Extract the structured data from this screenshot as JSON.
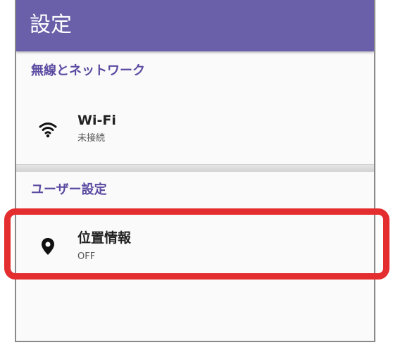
{
  "appbar": {
    "title": "設定"
  },
  "sections": [
    {
      "header": "無線とネットワーク",
      "items": [
        {
          "icon": "wifi-icon",
          "title": "Wi-Fi",
          "subtitle": "未接続"
        }
      ]
    },
    {
      "header": "ユーザー設定",
      "items": [
        {
          "icon": "location-pin-icon",
          "title": "位置情報",
          "subtitle": "OFF"
        }
      ]
    }
  ],
  "colors": {
    "appbar": "#6a5fa9",
    "section_header": "#5b4aa1",
    "highlight": "#e42d2f"
  }
}
